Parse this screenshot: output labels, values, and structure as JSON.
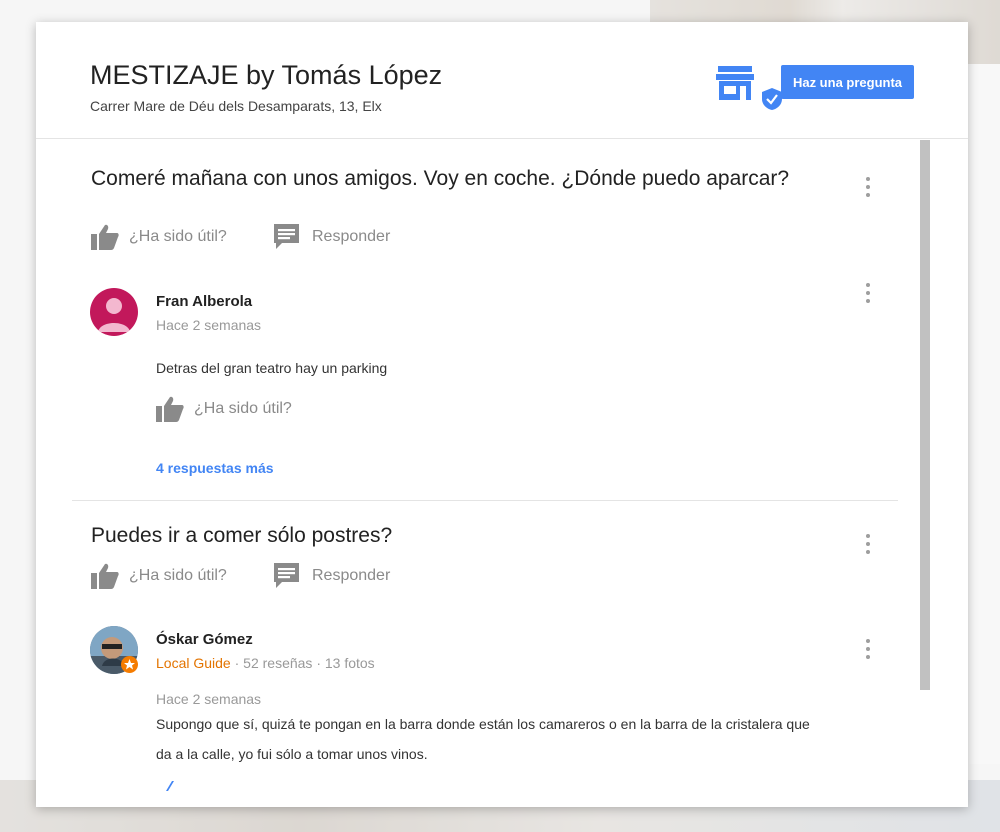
{
  "business": {
    "name": "MESTIZAJE by Tomás López",
    "address": "Carrer Mare de Déu dels Desamparats, 13, Elx",
    "ask_button": "Haz una pregunta",
    "store_icon": "store-icon",
    "verified_icon": "verified-check-icon"
  },
  "questions": [
    {
      "text": "Comeré mañana con unos amigos. Voy en coche. ¿Dónde puedo aparcar?",
      "helpful_label": "¿Ha sido útil?",
      "reply_label": "Responder",
      "answer": {
        "author": "Fran Alberola",
        "time": "Hace 2 semanas",
        "text": "Detras del gran teatro hay un parking",
        "helpful_label": "¿Ha sido útil?"
      },
      "more_answers": "4 respuestas más"
    },
    {
      "text": "Puedes ir a comer sólo postres?",
      "helpful_label": "¿Ha sido útil?",
      "reply_label": "Responder",
      "answer": {
        "author": "Óskar Gómez",
        "badge": "Local Guide",
        "stats": " · 52 reseñas · 13 fotos",
        "time": "Hace 2 semanas",
        "text": "Supongo que sí, quizá te pongan en la barra donde están los camareros o en la barra de la cristalera que da a la calle, yo fui sólo a tomar unos vinos."
      }
    }
  ],
  "colors": {
    "accent": "#4285f4",
    "local_guide": "#e37400",
    "avatar_pink": "#c2185b"
  }
}
